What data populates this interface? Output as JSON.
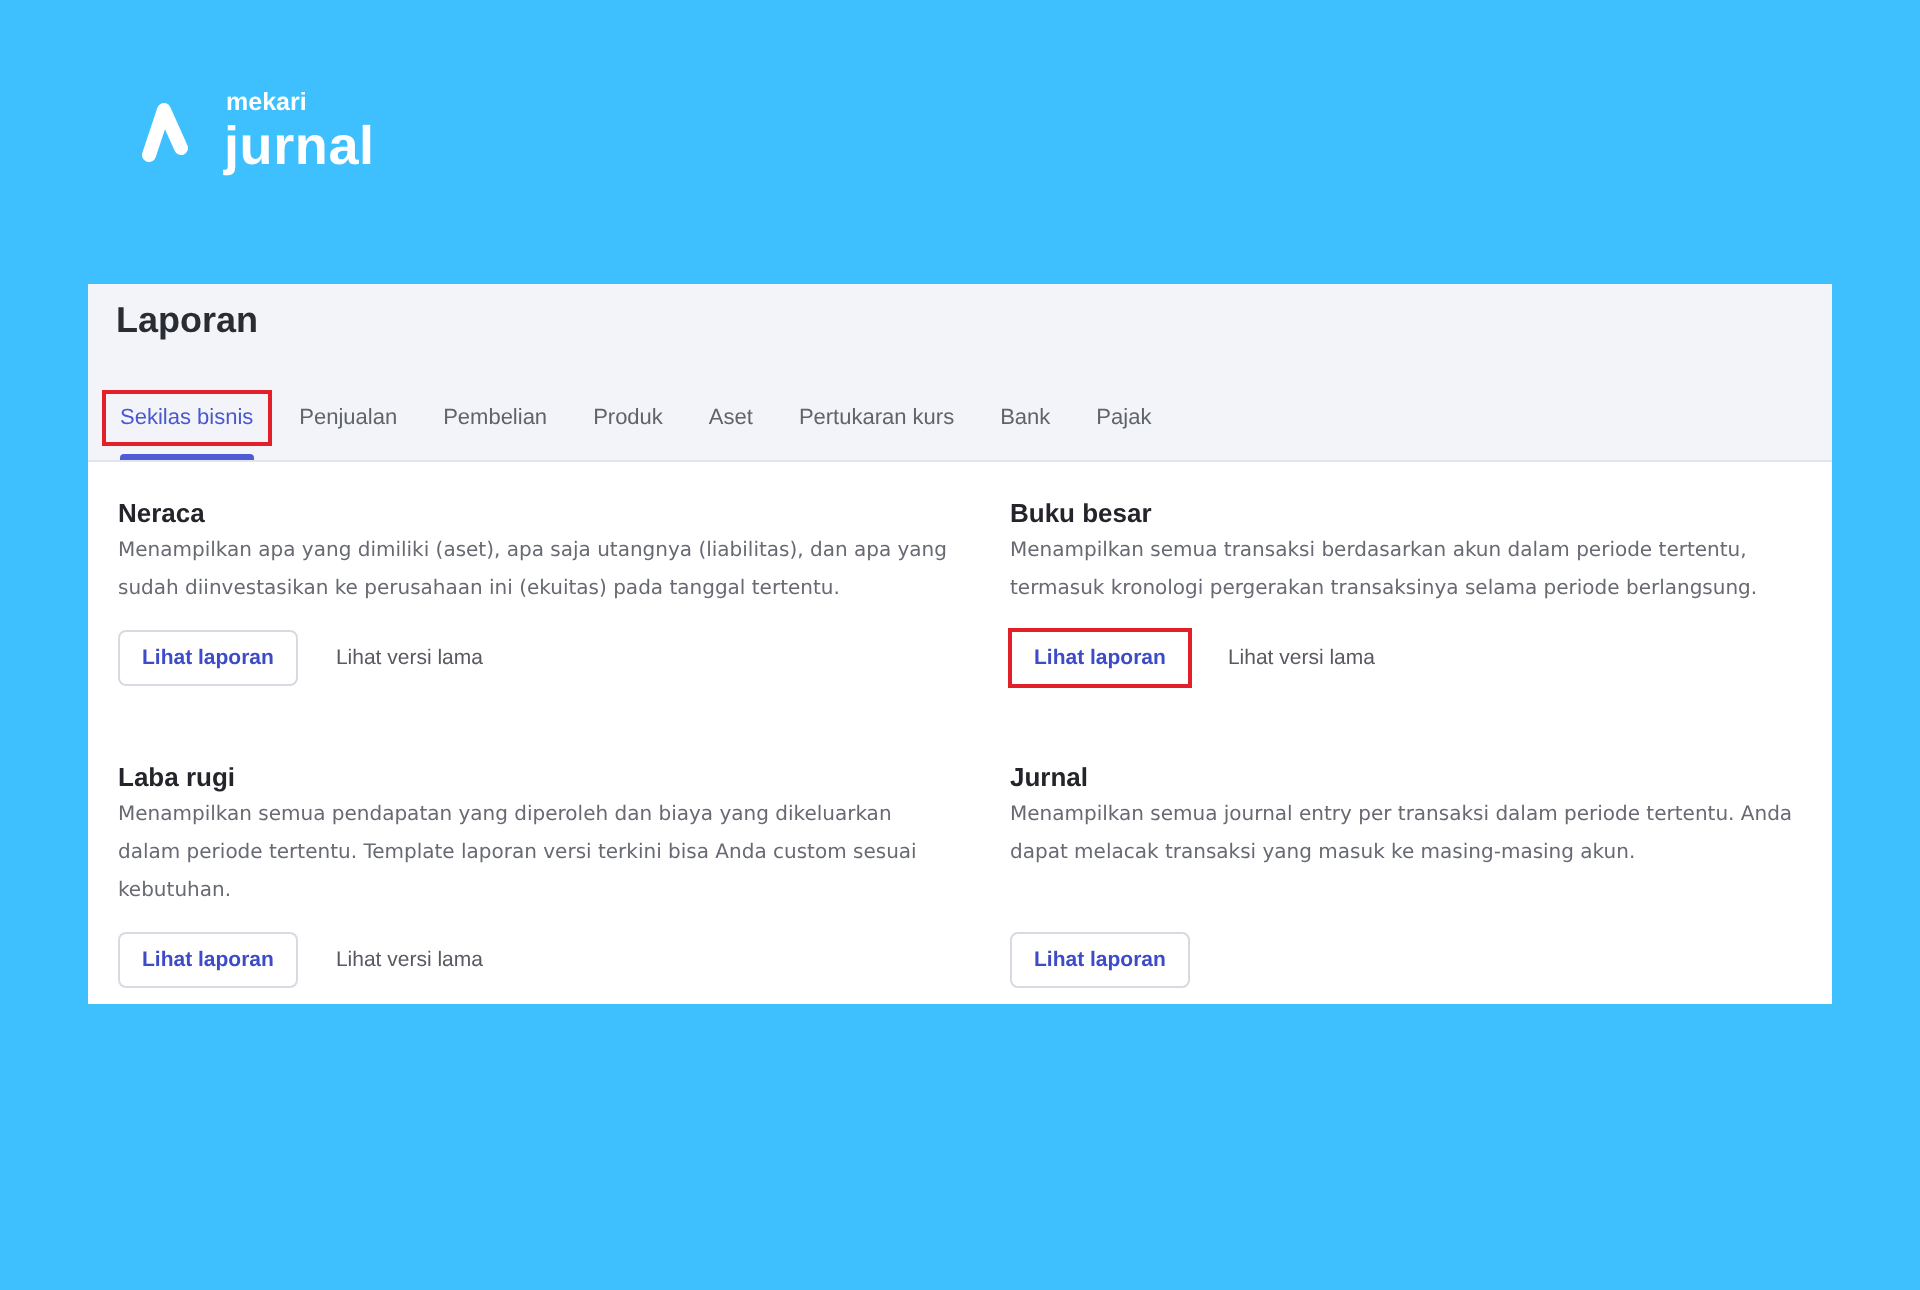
{
  "logo": {
    "brand": "mekari",
    "product": "jurnal"
  },
  "page": {
    "title": "Laporan"
  },
  "tabs": [
    {
      "label": "Sekilas bisnis",
      "selected": true,
      "highlighted": true
    },
    {
      "label": "Penjualan",
      "selected": false,
      "highlighted": false
    },
    {
      "label": "Pembelian",
      "selected": false,
      "highlighted": false
    },
    {
      "label": "Produk",
      "selected": false,
      "highlighted": false
    },
    {
      "label": "Aset",
      "selected": false,
      "highlighted": false
    },
    {
      "label": "Pertukaran kurs",
      "selected": false,
      "highlighted": false
    },
    {
      "label": "Bank",
      "selected": false,
      "highlighted": false
    },
    {
      "label": "Pajak",
      "selected": false,
      "highlighted": false
    }
  ],
  "reports": [
    {
      "title": "Neraca",
      "description": "Menampilkan apa yang dimiliki (aset), apa saja utangnya (liabilitas), dan apa yang sudah diinvestasikan ke perusahaan ini (ekuitas) pada tanggal tertentu.",
      "buttons": [
        {
          "kind": "outlined",
          "label": "Lihat laporan",
          "highlighted": false
        },
        {
          "kind": "link",
          "label": "Lihat versi lama",
          "highlighted": false
        }
      ]
    },
    {
      "title": "Buku besar",
      "description": "Menampilkan semua transaksi berdasarkan akun dalam periode tertentu, termasuk kronologi pergerakan transaksinya selama periode berlangsung.",
      "buttons": [
        {
          "kind": "outlined",
          "label": "Lihat laporan",
          "highlighted": true
        },
        {
          "kind": "link",
          "label": "Lihat versi lama",
          "highlighted": false
        }
      ]
    },
    {
      "title": "Laba rugi",
      "description": "Menampilkan semua pendapatan yang diperoleh dan biaya yang dikeluarkan dalam periode tertentu. Template laporan versi terkini bisa Anda custom sesuai kebutuhan.",
      "buttons": [
        {
          "kind": "outlined",
          "label": "Lihat laporan",
          "highlighted": false
        },
        {
          "kind": "link",
          "label": "Lihat versi lama",
          "highlighted": false
        }
      ]
    },
    {
      "title": "Jurnal",
      "description": "Menampilkan semua journal entry per transaksi dalam periode tertentu. Anda dapat melacak transaksi yang masuk ke masing-masing akun.",
      "buttons": [
        {
          "kind": "outlined",
          "label": "Lihat laporan",
          "highlighted": false
        }
      ]
    }
  ]
}
